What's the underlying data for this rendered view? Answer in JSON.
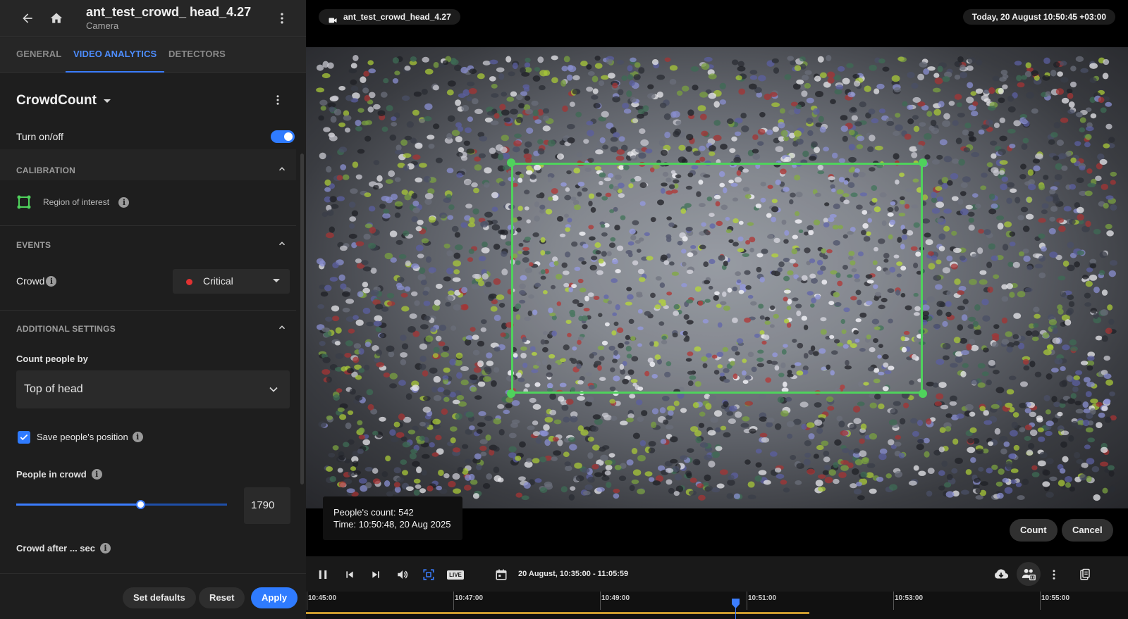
{
  "header": {
    "title": "ant_test_crowd_ head_4.27",
    "subtitle": "Camera",
    "icons": [
      "back-arrow-icon",
      "home-icon",
      "more-vertical-icon"
    ]
  },
  "tabs": [
    {
      "label": "GENERAL",
      "active": false
    },
    {
      "label": "VIDEO ANALYTICS",
      "active": true
    },
    {
      "label": "DETECTORS",
      "active": false
    }
  ],
  "module": {
    "name": "CrowdCount",
    "toggle_label": "Turn on/off",
    "enabled": true
  },
  "calibration": {
    "title": "CALIBRATION",
    "roi_label": "Region of interest"
  },
  "events": {
    "title": "EVENTS",
    "crowd_label": "Crowd",
    "severity": "Critical",
    "severity_color": "#e23232"
  },
  "additional": {
    "title": "ADDITIONAL SETTINGS",
    "count_by_label": "Count people by",
    "count_by_value": "Top of head",
    "save_position_label": "Save people's position",
    "save_position_checked": true,
    "people_in_crowd_label": "People in crowd",
    "people_in_crowd_value": "1790",
    "people_in_crowd_fraction": 0.59,
    "crowd_after_label": "Crowd after ... sec"
  },
  "footer": {
    "set_defaults": "Set defaults",
    "reset": "Reset",
    "apply": "Apply"
  },
  "video": {
    "camera_name": "ant_test_crowd_head_4.27",
    "timestamp": "Today, 20 August 10:50:45 +03:00",
    "tooltip_count": "People's count: 542",
    "tooltip_time": "Time: 10:50:48, 20 Aug 2025",
    "count_button": "Count",
    "cancel_button": "Cancel",
    "roi_color": "#4fd25c"
  },
  "controls": {
    "range": "20 August, 10:35:00 - 11:05:59",
    "live_label": "LIVE"
  },
  "timeline": {
    "ticks": [
      "10:45:00",
      "10:47:00",
      "10:49:00",
      "10:51:00",
      "10:53:00",
      "10:55:00"
    ]
  },
  "colors": {
    "accent": "#2f7bff",
    "panel_bg": "#1e1e1e"
  }
}
